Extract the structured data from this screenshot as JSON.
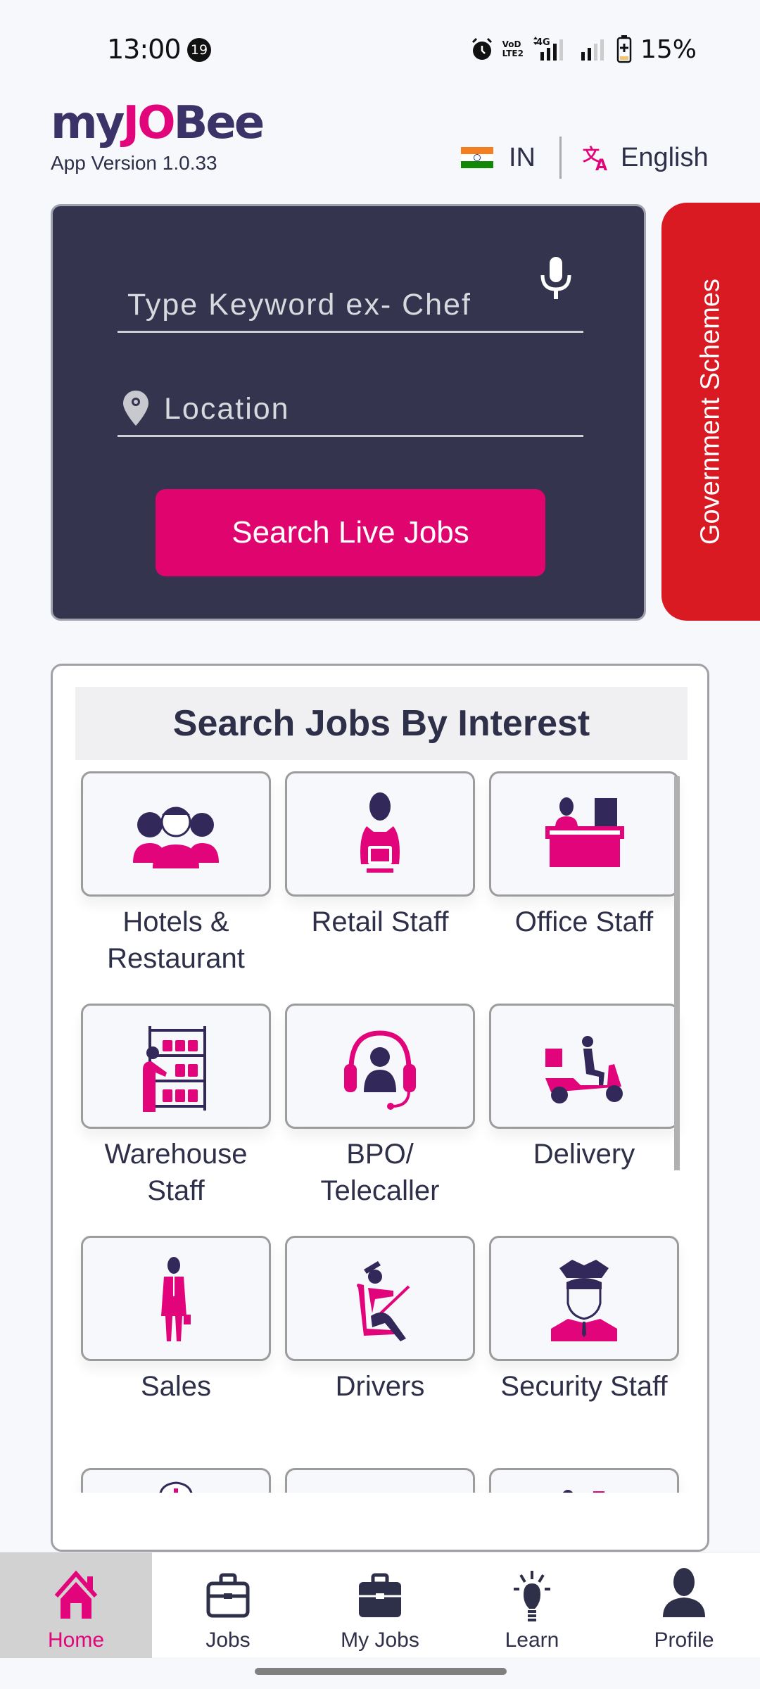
{
  "status_bar": {
    "time": "13:00",
    "notification_count": "19",
    "network_label_top": "VoD",
    "network_label_bottom": "LTE2",
    "network_type": "4G",
    "battery_percent": "15%",
    "icons": [
      "alarm-icon",
      "volte-icon",
      "signal-4g-icon",
      "signal-icon",
      "battery-charging-icon"
    ]
  },
  "header": {
    "logo_parts": [
      "my",
      "JO",
      "Bee"
    ],
    "app_version": "App Version 1.0.33",
    "country_code": "IN",
    "language": "English"
  },
  "search": {
    "keyword_placeholder": "Type Keyword ex- Chef",
    "keyword_value": "",
    "location_placeholder": "Location",
    "location_value": "",
    "button_label": "Search Live Jobs"
  },
  "side_tab": {
    "label": "Government Schemes"
  },
  "interests": {
    "title": "Search Jobs By Interest",
    "items": [
      {
        "label": "Hotels & Restaurant",
        "icon": "hotel-staff-icon"
      },
      {
        "label": "Retail Staff",
        "icon": "retail-staff-icon"
      },
      {
        "label": "Office Staff",
        "icon": "office-staff-icon"
      },
      {
        "label": "Warehouse Staff",
        "icon": "warehouse-icon"
      },
      {
        "label": "BPO/ Telecaller",
        "icon": "headset-icon"
      },
      {
        "label": "Delivery",
        "icon": "delivery-scooter-icon"
      },
      {
        "label": "Sales",
        "icon": "salesman-icon"
      },
      {
        "label": "Drivers",
        "icon": "driver-icon"
      },
      {
        "label": "Security Staff",
        "icon": "security-guard-icon"
      },
      {
        "label": "",
        "icon": "nurse-icon"
      },
      {
        "label": "",
        "icon": "technician-icon"
      },
      {
        "label": "",
        "icon": "machine-operator-icon"
      }
    ]
  },
  "bottom_nav": {
    "items": [
      {
        "label": "Home",
        "icon": "home-icon",
        "active": true
      },
      {
        "label": "Jobs",
        "icon": "briefcase-outline-icon",
        "active": false
      },
      {
        "label": "My Jobs",
        "icon": "briefcase-filled-icon",
        "active": false
      },
      {
        "label": "Learn",
        "icon": "lightbulb-icon",
        "active": false
      },
      {
        "label": "Profile",
        "icon": "person-icon",
        "active": false
      }
    ]
  },
  "colors": {
    "brand_magenta": "#e0046f",
    "brand_navy": "#34344e",
    "logo_purple": "#3b3268",
    "gov_red": "#da1a22",
    "background": "#f7f8fc"
  }
}
